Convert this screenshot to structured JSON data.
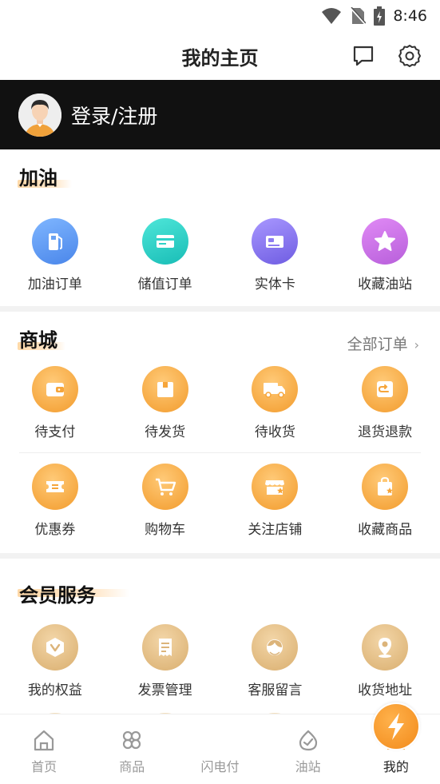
{
  "status": {
    "time": "8:46"
  },
  "header": {
    "title": "我的主页"
  },
  "login": {
    "label": "登录/注册"
  },
  "fuel": {
    "title": "加油",
    "items": [
      {
        "label": "加油订单",
        "icon": "fuel-pump-icon"
      },
      {
        "label": "储值订单",
        "icon": "card-icon"
      },
      {
        "label": "实体卡",
        "icon": "physical-card-icon"
      },
      {
        "label": "收藏油站",
        "icon": "star-icon"
      }
    ]
  },
  "mall": {
    "title": "商城",
    "all_orders": "全部订单",
    "row1": [
      {
        "label": "待支付",
        "icon": "wallet-icon"
      },
      {
        "label": "待发货",
        "icon": "box-icon"
      },
      {
        "label": "待收货",
        "icon": "truck-icon"
      },
      {
        "label": "退货退款",
        "icon": "return-icon"
      }
    ],
    "row2": [
      {
        "label": "优惠券",
        "icon": "coupon-icon"
      },
      {
        "label": "购物车",
        "icon": "cart-icon"
      },
      {
        "label": "关注店铺",
        "icon": "store-icon"
      },
      {
        "label": "收藏商品",
        "icon": "bag-star-icon"
      }
    ]
  },
  "member": {
    "title": "会员服务",
    "items": [
      {
        "label": "我的权益",
        "icon": "benefit-icon"
      },
      {
        "label": "发票管理",
        "icon": "invoice-icon"
      },
      {
        "label": "客服留言",
        "icon": "service-icon"
      },
      {
        "label": "收货地址",
        "icon": "location-icon"
      }
    ]
  },
  "nav": {
    "home": "首页",
    "goods": "商品",
    "flash_pay": "闪电付",
    "station": "油站",
    "mine": "我的"
  },
  "colors": {
    "login_bar": "#111111",
    "mall_icon": "#f6a53a",
    "member_icon": "#e2bd86",
    "fuel_icons": [
      "#5b9cf0",
      "#2fd1c7",
      "#8e7cf1",
      "#c974e6"
    ]
  }
}
